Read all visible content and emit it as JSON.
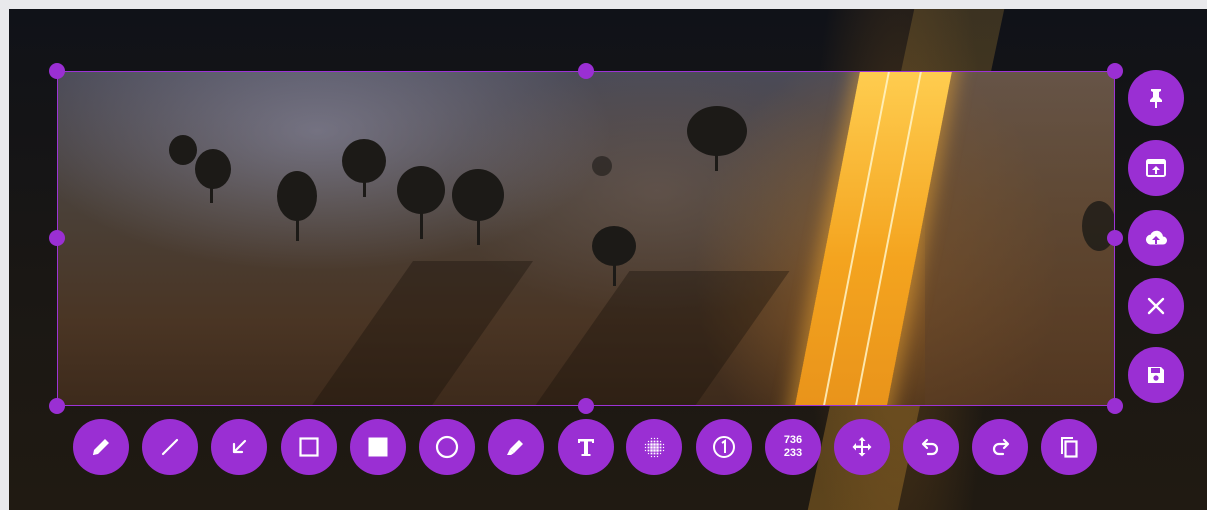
{
  "accent_color": "#9a2fd3",
  "side_toolbar": [
    {
      "name": "pin-button",
      "icon": "pin-icon"
    },
    {
      "name": "open-in-window-button",
      "icon": "open-window-icon"
    },
    {
      "name": "upload-button",
      "icon": "cloud-upload-icon"
    },
    {
      "name": "close-button",
      "icon": "close-icon"
    },
    {
      "name": "save-button",
      "icon": "save-icon"
    }
  ],
  "bottom_toolbar": [
    {
      "name": "pencil-tool-button",
      "icon": "pencil-icon"
    },
    {
      "name": "line-tool-button",
      "icon": "line-icon"
    },
    {
      "name": "arrow-tool-button",
      "icon": "arrow-icon"
    },
    {
      "name": "rectangle-tool-button",
      "icon": "rectangle-outline-icon"
    },
    {
      "name": "filled-rectangle-tool-button",
      "icon": "rectangle-filled-icon"
    },
    {
      "name": "circle-tool-button",
      "icon": "circle-outline-icon"
    },
    {
      "name": "marker-tool-button",
      "icon": "marker-icon"
    },
    {
      "name": "text-tool-button",
      "icon": "text-icon"
    },
    {
      "name": "pixelate-tool-button",
      "icon": "pixelate-icon"
    },
    {
      "name": "counter-tool-button",
      "icon": "counter-icon"
    },
    {
      "name": "selection-size-indicator",
      "icon": "size-indicator"
    },
    {
      "name": "move-selection-button",
      "icon": "move-icon"
    },
    {
      "name": "undo-button",
      "icon": "undo-icon"
    },
    {
      "name": "redo-button",
      "icon": "redo-icon"
    },
    {
      "name": "copy-to-clipboard-button",
      "icon": "copy-icon"
    }
  ],
  "selection": {
    "width": "736",
    "height": "233"
  }
}
